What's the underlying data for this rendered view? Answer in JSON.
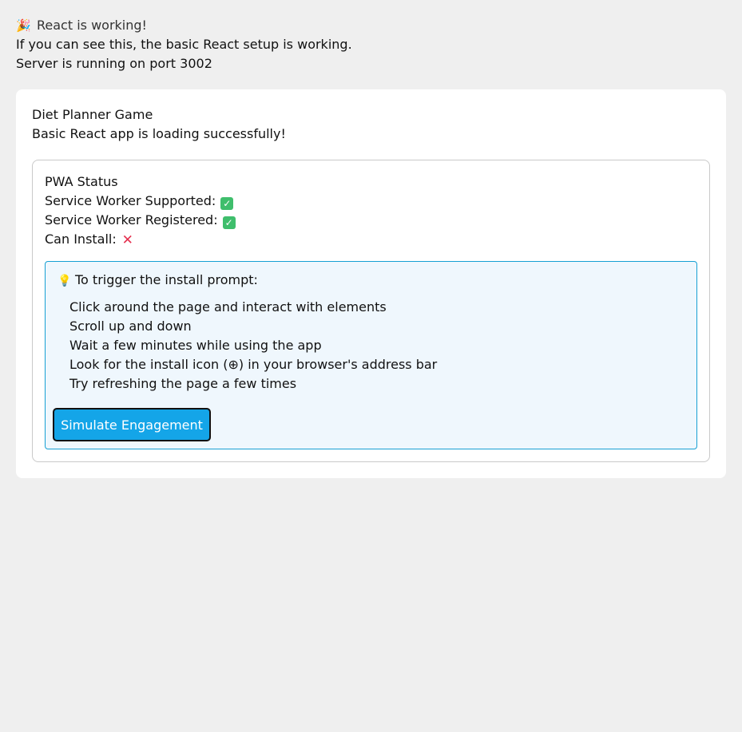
{
  "banner": {
    "icon": "party-popper-icon",
    "working_text": "React is working!",
    "setup_text": "If you can see this, the basic React setup is working.",
    "server_text": "Server is running on port 3002"
  },
  "card": {
    "title": "Diet Planner Game",
    "subtitle": "Basic React app is loading successfully!",
    "pwa": {
      "heading": "PWA Status",
      "sw_supported_label": "Service Worker Supported:",
      "sw_supported_state": "check-icon",
      "sw_registered_label": "Service Worker Registered:",
      "sw_registered_state": "check-icon",
      "can_install_label": "Can Install:",
      "can_install_state": "cross-icon",
      "tip": {
        "icon": "lightbulb-icon",
        "title": "To trigger the install prompt:",
        "items": [
          "Click around the page and interact with elements",
          "Scroll up and down",
          "Wait a few minutes while using the app",
          "Look for the install icon (⊕) in your browser's address bar",
          "Try refreshing the page a few times"
        ],
        "button_label": "Simulate Engagement"
      }
    }
  },
  "colors": {
    "page_background": "#efefef",
    "card_background": "#ffffff",
    "tip_background": "#eff7fd",
    "tip_border": "#16a0d3",
    "button_background": "#14a5e8",
    "check_green": "#3fbe6c",
    "cross_red": "#e5304f"
  }
}
